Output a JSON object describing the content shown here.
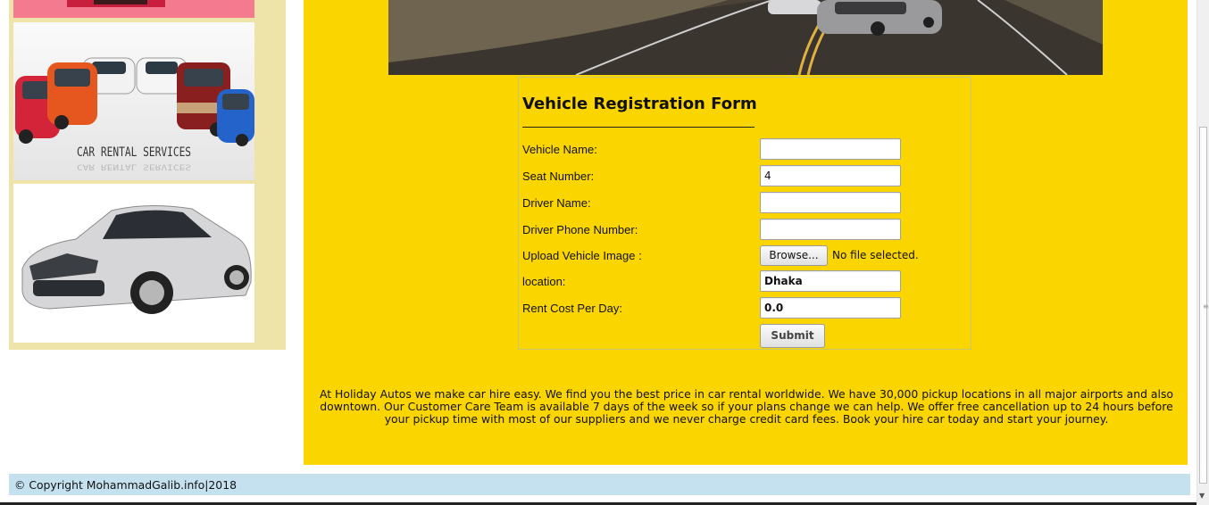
{
  "sidebar": {
    "rental_image_caption": "CAR RENTAL SERVICES"
  },
  "form": {
    "title": "Vehicle Registration Form",
    "fields": [
      {
        "label": "Vehicle Name:",
        "value": "",
        "placeholder": ""
      },
      {
        "label": "Seat Number:",
        "value": "4",
        "placeholder": ""
      },
      {
        "label": "Driver Name:",
        "value": "",
        "placeholder": ""
      },
      {
        "label": "Driver Phone Number:",
        "value": "",
        "placeholder": ""
      }
    ],
    "upload": {
      "label": "Upload Vehicle Image :",
      "button_label": "Browse...",
      "status": "No file selected."
    },
    "location": {
      "label": "location:",
      "value": "Dhaka"
    },
    "rent": {
      "label": "Rent Cost Per Day:",
      "value": "0.0"
    },
    "submit_label": "Submit"
  },
  "about_text": "At Holiday Autos we make car hire easy. We find you the best price in car rental worldwide. We have 30,000 pickup locations in all major airports and also downtown. Our Customer Care Team is available 7 days of the week so if your plans change we can help. We offer free cancellation up to 24 hours before your pickup time with most of our suppliers and we never charge credit card fees. Book your hire car today and start your journey.",
  "footer": {
    "copyright": "© Copyright MohammadGalib.info|2018"
  },
  "colors": {
    "main_background": "#fbd500",
    "sidebar_background": "#eee3a8",
    "footer_background": "#c5e1ef"
  },
  "icons": {
    "scroll_down": "scroll-down-arrow-icon",
    "scroll_grip": "scroll-grip-icon"
  }
}
